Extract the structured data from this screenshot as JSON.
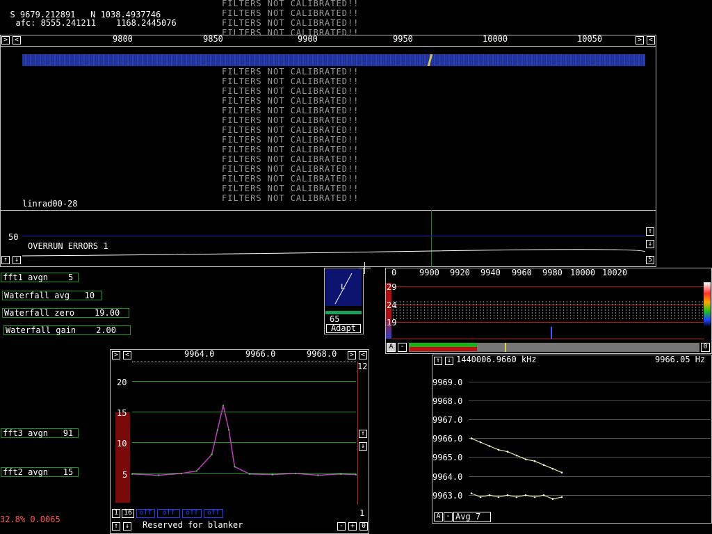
{
  "status": {
    "s_label": "S",
    "s_value": "9679.212891",
    "n_label": "N",
    "n_value": "1038.4937746",
    "afc_label": "afc:",
    "afc_value1": "8555.241211",
    "afc_value2": "1168.2445076"
  },
  "warning_text": "FILTERS NOT CALIBRATED!!",
  "main_spectrum": {
    "ticks": [
      "9800",
      "9850",
      "9900",
      "9950",
      "10000",
      "10050"
    ],
    "label": "linrad00-28",
    "overrun_text": "OVERRUN ERRORS 1",
    "level_label": "50",
    "right_number": "5"
  },
  "params_left": [
    {
      "name": "fft1 avgn",
      "value": "5"
    },
    {
      "name": "Waterfall avg",
      "value": "10"
    },
    {
      "name": "Waterfall zero",
      "value": "19.00"
    },
    {
      "name": "Waterfall gain",
      "value": "2.00"
    }
  ],
  "params_lower": [
    {
      "name": "fft3 avgn",
      "value": "91"
    },
    {
      "name": "fft2 avgn",
      "value": "15"
    }
  ],
  "cpu_text": "32.8% 0.0065",
  "cpu_color": "#ff5555",
  "small_panel": {
    "letter": "L",
    "number": "65",
    "adapt_label": "Adapt"
  },
  "right_spectrum": {
    "zero_label": "0",
    "ticks": [
      "9900",
      "9920",
      "9940",
      "9960",
      "9980",
      "10000",
      "10020"
    ],
    "levels": [
      "29",
      "24",
      "19"
    ],
    "a_button": "A",
    "minus_button": "-",
    "right_number": "0"
  },
  "baseband": {
    "ticks": [
      "9964.0",
      "9966.0",
      "9968.0"
    ],
    "levels": [
      "20",
      "15",
      "10",
      "5"
    ],
    "right_top_number": "12",
    "right_bottom_number": "1",
    "bottom_left_1": "1",
    "bottom_left_16": "16",
    "blanker_buttons": [
      "off",
      "off",
      "off",
      "off"
    ],
    "reserved_text": "Reserved for blanker",
    "minus_button": "-",
    "plus_button": "+",
    "zero_button": "0",
    "chart_data": {
      "type": "line",
      "xlabel": "",
      "ylabel": "",
      "xlim": [
        9963.3,
        9969.2
      ],
      "ylim": [
        0,
        22
      ],
      "series": [
        {
          "values": [
            [
              9963.3,
              4.8
            ],
            [
              9964.0,
              4.6
            ],
            [
              9964.6,
              4.9
            ],
            [
              9965.0,
              5.3
            ],
            [
              9965.4,
              8
            ],
            [
              9965.55,
              12
            ],
            [
              9965.7,
              16
            ],
            [
              9965.85,
              12
            ],
            [
              9966.0,
              6
            ],
            [
              9966.4,
              4.8
            ],
            [
              9967.0,
              4.7
            ],
            [
              9967.6,
              4.9
            ],
            [
              9968.2,
              4.6
            ],
            [
              9968.8,
              4.8
            ],
            [
              9969.2,
              4.7
            ]
          ]
        }
      ]
    }
  },
  "freq_track": {
    "header_left": "1440006.9660 kHz",
    "header_right": "9966.05 Hz",
    "levels": [
      "9969.0",
      "9968.0",
      "9967.0",
      "9966.0",
      "9965.0",
      "9964.0",
      "9963.0"
    ],
    "a_button": "A",
    "minus_button": "-",
    "avg_label": "Avg",
    "avg_value": "7",
    "chart_data": {
      "type": "line",
      "xlabel": "",
      "ylabel": "",
      "ylim": [
        9962.6,
        9969.2
      ],
      "x": [
        0,
        1,
        2,
        3,
        4,
        5,
        6,
        7,
        8,
        9,
        10
      ],
      "series": [
        {
          "values": [
            9966.0,
            9965.8,
            9965.6,
            9965.4,
            9965.3,
            9965.1,
            9964.9,
            9964.8,
            9964.6,
            9964.4,
            9964.2
          ]
        },
        {
          "values": [
            9963.1,
            9962.9,
            9963.0,
            9962.9,
            9963.0,
            9962.9,
            9963.0,
            9962.9,
            9963.0,
            9962.8,
            9962.9
          ]
        }
      ]
    }
  }
}
